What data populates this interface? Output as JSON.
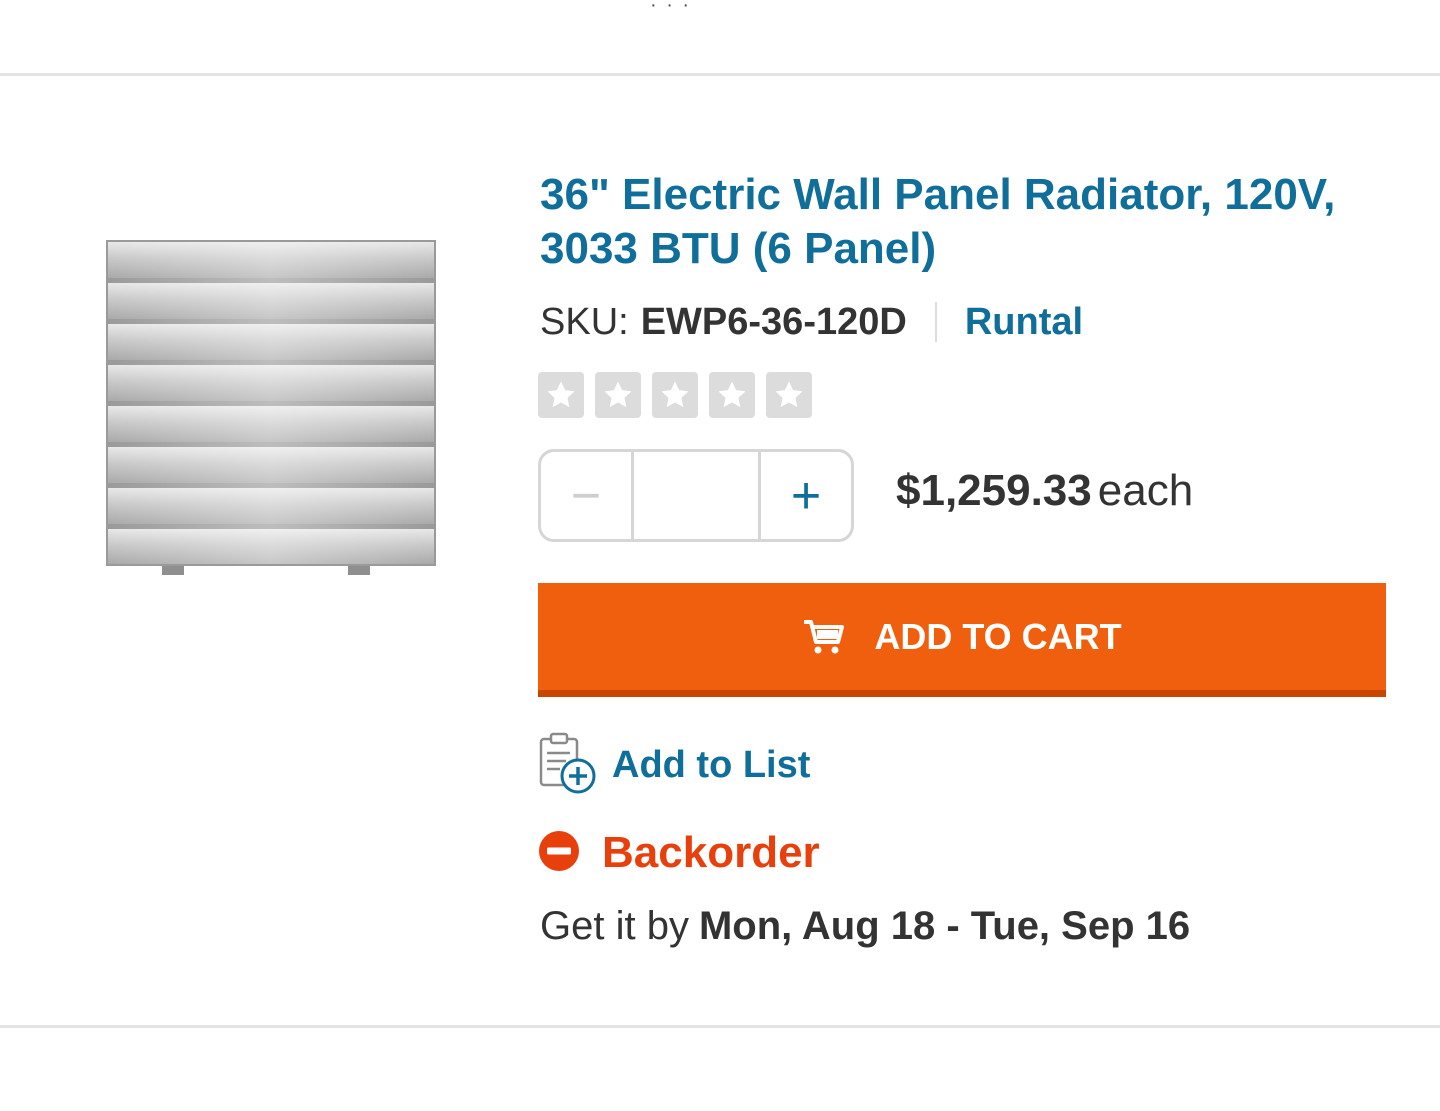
{
  "product": {
    "title": "36\" Electric Wall Panel Radiator, 120V, 3033 BTU (6 Panel)",
    "image_alt": "Electric wall panel radiator",
    "sku_label": "SKU:",
    "sku": "EWP6-36-120D",
    "brand": "Runtal",
    "rating": {
      "stars_filled": 0,
      "stars_total": 5
    },
    "quantity": "",
    "quantity_minus": "−",
    "quantity_plus": "+",
    "price": "$1,259.33",
    "price_unit": "each"
  },
  "actions": {
    "add_to_cart": "ADD TO CART",
    "add_to_list": "Add to List"
  },
  "availability": {
    "status": "Backorder",
    "delivery_prefix": "Get it by",
    "delivery_dates": "Mon, Aug 18 - Tue, Sep 16"
  },
  "colors": {
    "link": "#106e9a",
    "primary_button": "#f05f0d",
    "status_backorder": "#e8400c",
    "star_empty": "#dcdcdc"
  },
  "icons": {
    "cart": "cart-icon",
    "list": "clipboard-add-icon",
    "status": "minus-circle-icon",
    "star": "star-icon"
  }
}
